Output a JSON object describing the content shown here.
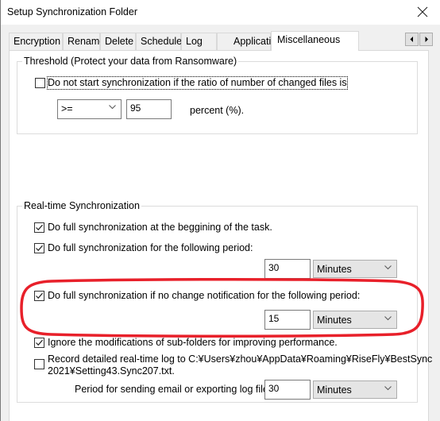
{
  "window": {
    "title": "Setup Synchronization Folder",
    "close_icon": "close-icon"
  },
  "tabs": [
    {
      "label": "Encryption",
      "active": false
    },
    {
      "label": "Rename",
      "active": false
    },
    {
      "label": "Delete",
      "active": false
    },
    {
      "label": "Schedule",
      "active": false
    },
    {
      "label": "Log",
      "active": false
    },
    {
      "label": "Application",
      "active": false
    },
    {
      "label": "Miscellaneous",
      "active": true
    }
  ],
  "tab_scroll": {
    "left_icon": "triangle-left-icon",
    "right_icon": "triangle-right-icon"
  },
  "threshold": {
    "title": "Threshold (Protect your data from Ransomware)",
    "checkbox_label": "Do not start synchronization if the ratio of number of changed files is",
    "checked": false,
    "operator": ">=",
    "value": "95",
    "unit_label": "percent (%)."
  },
  "realtime": {
    "title": "Real-time Synchronization",
    "full_sync_begin": {
      "label": "Do full synchronization at the beggining of the task.",
      "checked": true
    },
    "full_sync_period": {
      "label": "Do full synchronization for the following period:",
      "checked": true,
      "value": "30",
      "unit": "Minutes"
    },
    "full_sync_no_change": {
      "label": "Do full synchronization if no change notification for the following period:",
      "checked": true,
      "value": "15",
      "unit": "Minutes"
    },
    "ignore_subfolders": {
      "label": "Ignore the modifications of sub-folders for improving performance.",
      "checked": true
    },
    "record_log": {
      "label_line1": "Record detailed real-time log to C:¥Users¥zhou¥AppData¥Roaming¥RiseFly¥BestSync",
      "label_line2": "2021¥Setting43.Sync207.txt.",
      "checked": false
    },
    "email_period": {
      "label": "Period for sending email or exporting log file:",
      "value": "30",
      "unit": "Minutes"
    }
  },
  "annotation": {
    "color": "#e8202a",
    "shape": "ellipse-highlight"
  }
}
